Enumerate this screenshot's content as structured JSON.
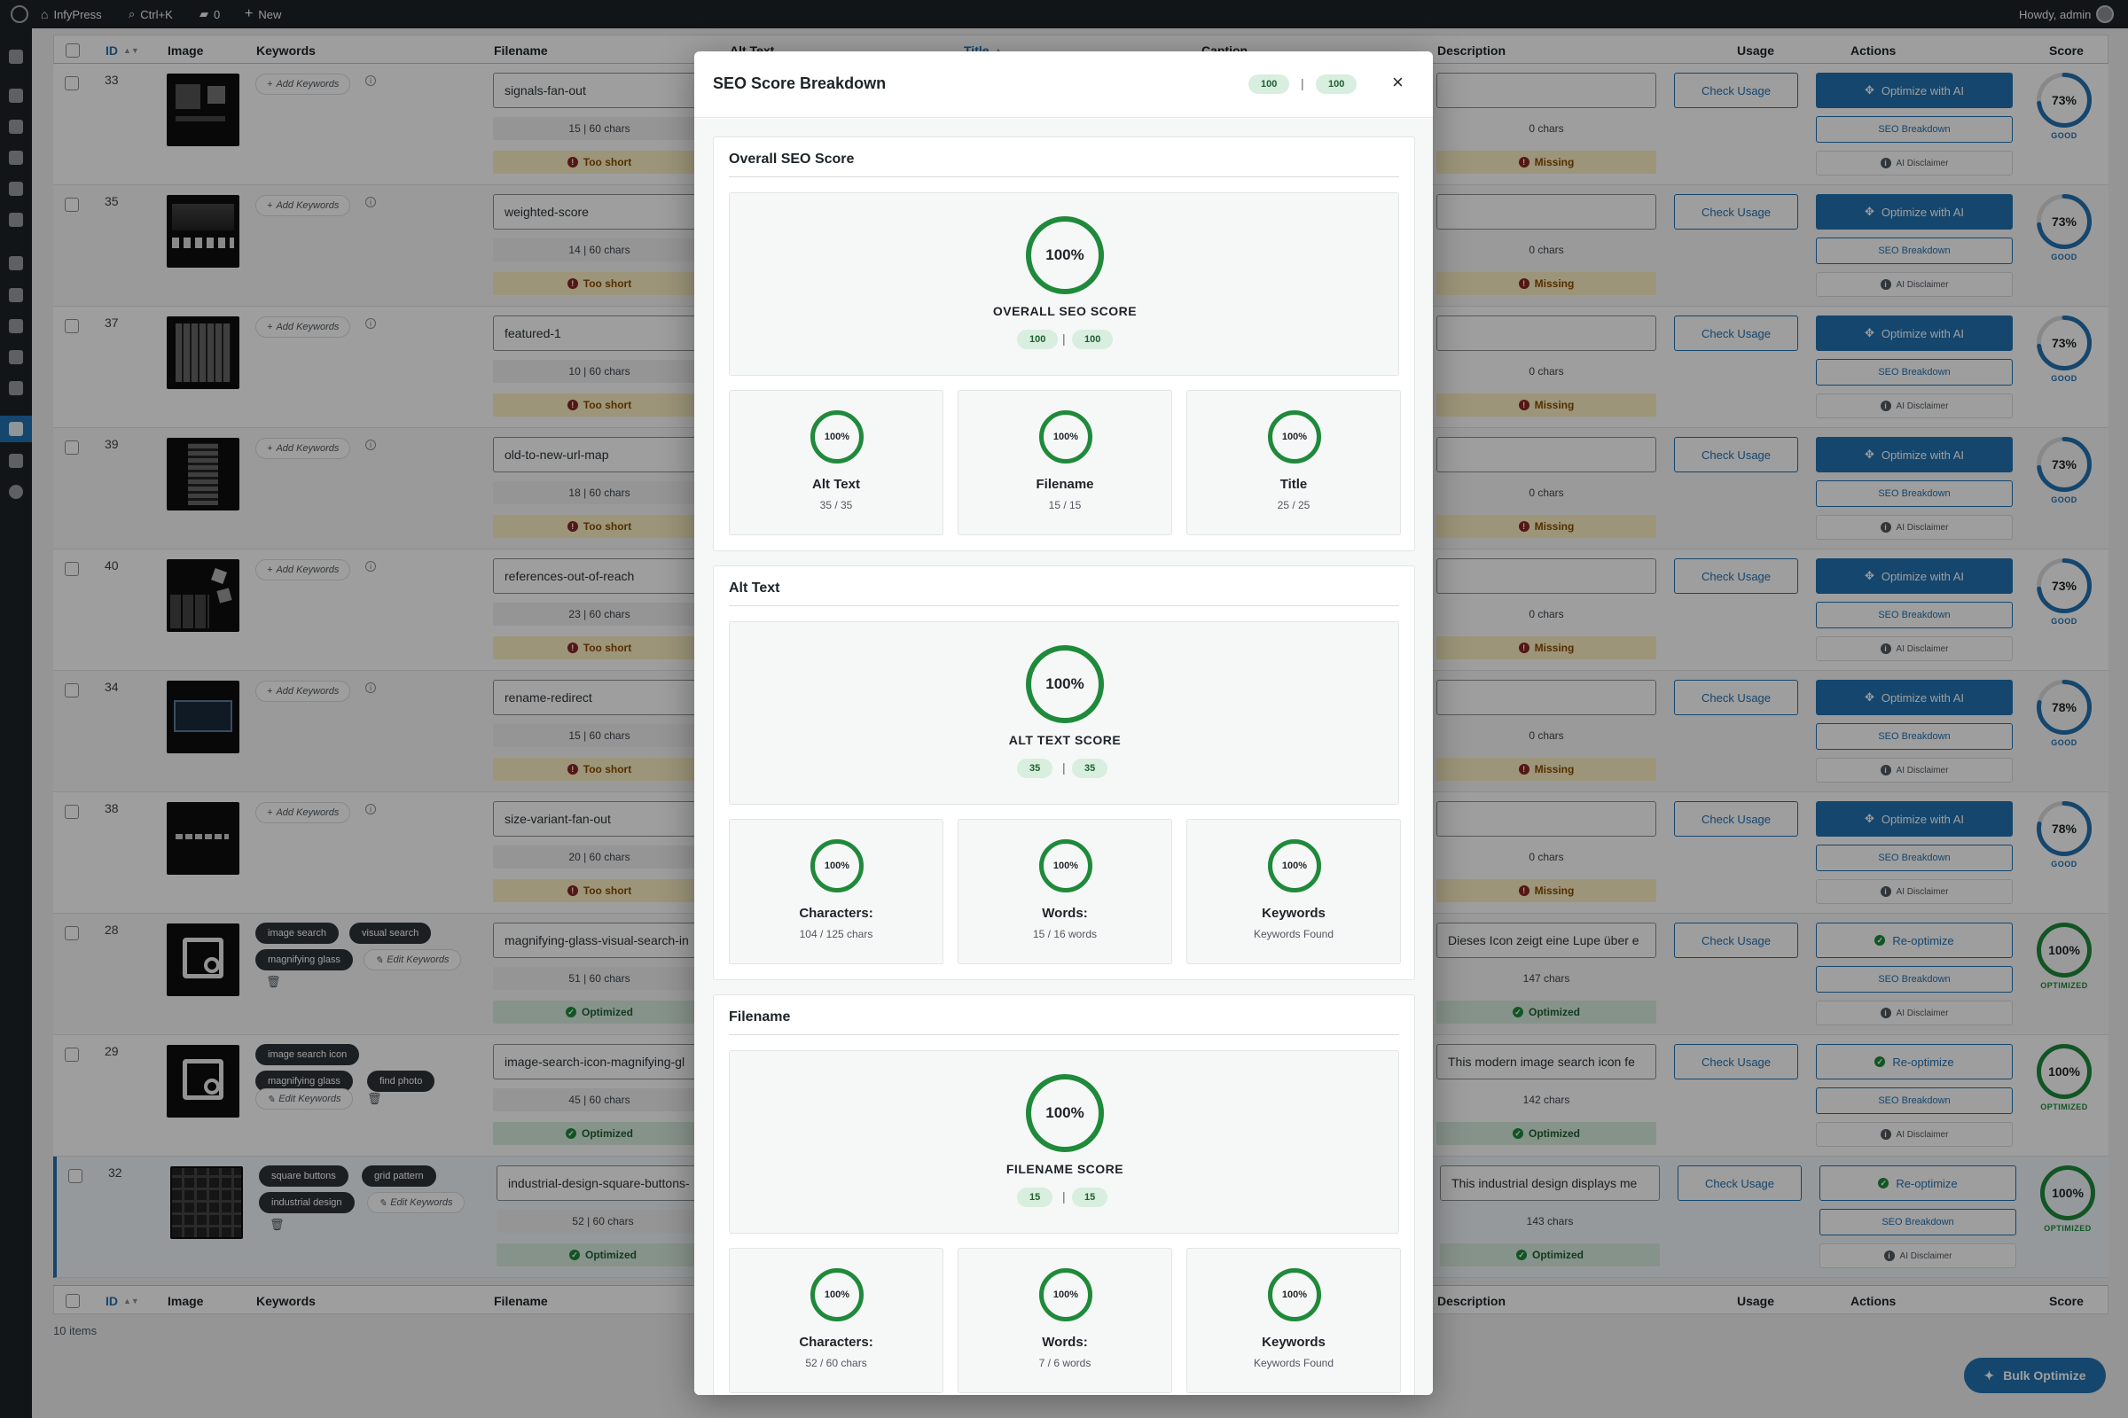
{
  "adminbar": {
    "site_name": "InfyPress",
    "search_shortcut": "Ctrl+K",
    "comments_count": "0",
    "new_label": "New",
    "howdy": "Howdy, admin"
  },
  "columns": {
    "id": "ID",
    "image": "Image",
    "keywords": "Keywords",
    "filename": "Filename",
    "alt_text": "Alt Text",
    "title": "Title",
    "caption": "Caption",
    "description": "Description",
    "usage": "Usage",
    "actions": "Actions",
    "score": "Score"
  },
  "labels": {
    "add_keywords": "Add Keywords",
    "edit_keywords": "Edit Keywords",
    "check_usage": "Check Usage",
    "optimize_ai": "Optimize with AI",
    "reoptimize": "Re-optimize",
    "seo_breakdown": "SEO Breakdown",
    "ai_disclaimer": "AI Disclaimer",
    "too_short": "Too short",
    "missing": "Missing",
    "optimized": "Optimized",
    "good": "GOOD",
    "optimized_caps": "OPTIMIZED"
  },
  "rows": [
    {
      "id": "33",
      "filename": "signals-fan-out",
      "fn_chars": "15 | 60 chars",
      "desc": "",
      "desc_chars": "0 chars",
      "score": "73%",
      "score_val": 73
    },
    {
      "id": "35",
      "filename": "weighted-score",
      "fn_chars": "14 | 60 chars",
      "desc": "",
      "desc_chars": "0 chars",
      "score": "73%",
      "score_val": 73
    },
    {
      "id": "37",
      "filename": "featured-1",
      "fn_chars": "10 | 60 chars",
      "desc": "",
      "desc_chars": "0 chars",
      "score": "73%",
      "score_val": 73
    },
    {
      "id": "39",
      "filename": "old-to-new-url-map",
      "fn_chars": "18 | 60 chars",
      "desc": "",
      "desc_chars": "0 chars",
      "score": "73%",
      "score_val": 73
    },
    {
      "id": "40",
      "filename": "references-out-of-reach",
      "fn_chars": "23 | 60 chars",
      "desc": "",
      "desc_chars": "0 chars",
      "score": "73%",
      "score_val": 73
    },
    {
      "id": "34",
      "filename": "rename-redirect",
      "fn_chars": "15 | 60 chars",
      "desc": "",
      "desc_chars": "0 chars",
      "score": "78%",
      "score_val": 78
    },
    {
      "id": "38",
      "filename": "size-variant-fan-out",
      "fn_chars": "20 | 60 chars",
      "desc": "",
      "desc_chars": "0 chars",
      "score": "78%",
      "score_val": 78
    },
    {
      "id": "28",
      "filename": "magnifying-glass-visual-search-in",
      "fn_chars": "51 | 60 chars",
      "desc": "Dieses Icon zeigt eine Lupe über e",
      "desc_chars": "147 chars",
      "score": "100%",
      "score_val": 100,
      "tags": [
        "image search",
        "visual search",
        "magnifying glass"
      ]
    },
    {
      "id": "29",
      "filename": "image-search-icon-magnifying-gl",
      "fn_chars": "45 | 60 chars",
      "desc": "This modern image search icon fe",
      "desc_chars": "142 chars",
      "score": "100%",
      "score_val": 100,
      "tags": [
        "image search icon",
        "magnifying glass",
        "find photo"
      ]
    },
    {
      "id": "32",
      "filename": "industrial-design-square-buttons-",
      "fn_chars": "52 | 60 chars",
      "desc": "This industrial design displays me",
      "desc_chars": "143 chars",
      "score": "100%",
      "score_val": 100,
      "tags": [
        "square buttons",
        "grid pattern",
        "industrial design"
      ]
    }
  ],
  "footer": {
    "items_count": "10 items",
    "bulk_optimize": "Bulk Optimize"
  },
  "modal": {
    "title": "SEO Score Breakdown",
    "pill_a": "100",
    "pill_b": "100",
    "separator": "|",
    "close_icon": "×",
    "overall": {
      "heading": "Overall SEO Score",
      "ring": "100%",
      "ring_value": 100,
      "label": "OVERALL SEO SCORE",
      "pill_a": "100",
      "pill_b": "100",
      "cards": [
        {
          "ring": "100%",
          "value": 100,
          "label": "Alt Text",
          "sub": "35 / 35"
        },
        {
          "ring": "100%",
          "value": 100,
          "label": "Filename",
          "sub": "15 / 15"
        },
        {
          "ring": "100%",
          "value": 100,
          "label": "Title",
          "sub": "25 / 25"
        }
      ]
    },
    "alt": {
      "heading": "Alt Text",
      "ring": "100%",
      "ring_value": 100,
      "label": "ALT TEXT SCORE",
      "pill_a": "35",
      "pill_b": "35",
      "cards": [
        {
          "ring": "100%",
          "value": 100,
          "label": "Characters:",
          "sub": "104 / 125 chars"
        },
        {
          "ring": "100%",
          "value": 100,
          "label": "Words:",
          "sub": "15 / 16 words"
        },
        {
          "ring": "100%",
          "value": 100,
          "label": "Keywords",
          "sub": "Keywords Found"
        }
      ]
    },
    "filename": {
      "heading": "Filename",
      "ring": "100%",
      "ring_value": 100,
      "label": "FILENAME SCORE",
      "pill_a": "15",
      "pill_b": "15",
      "cards": [
        {
          "ring": "100%",
          "value": 100,
          "label": "Characters:",
          "sub": "52 / 60 chars"
        },
        {
          "ring": "100%",
          "value": 100,
          "label": "Words:",
          "sub": "7 / 6 words"
        },
        {
          "ring": "100%",
          "value": 100,
          "label": "Keywords",
          "sub": "Keywords Found"
        }
      ]
    }
  },
  "colors": {
    "primary": "#2271b1",
    "success": "#1e8a3a",
    "warning_bg": "#fcf0c3",
    "success_bg": "#d8eedf"
  }
}
